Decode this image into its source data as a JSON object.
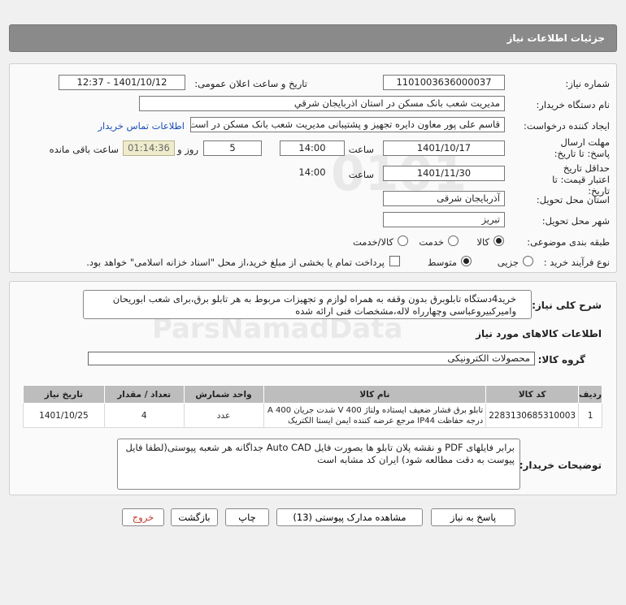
{
  "header": {
    "title": "جزئیات اطلاعات نیاز"
  },
  "form": {
    "need_number_label": "شماره نیاز:",
    "need_number": "1101003636000037",
    "announce_label": "تاریخ و ساعت اعلان عمومی:",
    "announce_value": "1401/10/12 - 12:37",
    "buyer_label": "نام دستگاه خریدار:",
    "buyer_value": "مدیریت شعب بانک مسکن در استان اذربایجان شرقي",
    "creator_label": "ایجاد کننده درخواست:",
    "creator_value": "قاسم علی پور معاون دایره تجهیز و پشتیبانی مدیریت شعب بانک مسکن در است",
    "contact_link": "اطلاعات تماس خریدار",
    "deadline_label": "مهلت ارسال پاسخ: تا تاریخ:",
    "deadline_date": "1401/10/17",
    "time_label": "ساعت",
    "deadline_time": "14:00",
    "days_value": "5",
    "days_label": "روز و",
    "remaining_time": "01:14:36",
    "remaining_label": "ساعت باقی مانده",
    "validity_label": "حداقل تاریخ اعتبار قیمت: تا تاریخ:",
    "validity_date": "1401/11/30",
    "validity_time_label": "ساعت",
    "validity_time": "14:00",
    "province_label": "استان محل تحویل:",
    "province_value": "آذربایجان شرقی",
    "city_label": "شهر محل تحویل:",
    "city_value": "تبریز",
    "category_label": "طبقه بندی موضوعی:",
    "category_options": [
      "کالا",
      "خدمت",
      "کالا/خدمت"
    ],
    "category_selected": "کالا",
    "process_label": "نوع فرآیند خرید :",
    "process_options": [
      "جزیی",
      "متوسط"
    ],
    "process_selected": "متوسط",
    "payment_note": "پرداخت تمام یا بخشی از مبلغ خرید،از محل \"اسناد خزانه اسلامی\" خواهد بود."
  },
  "summary": {
    "label": "شرح کلی نیاز:",
    "text": "خرید4دستگاه تابلوبرق بدون وقفه به همراه لوازم و تجهیزات مربوط به هر تابلو برق،برای شعب ابوریحان وامیرکبیروعباسی وچهارراه لاله،مشخصات فنی ارائه شده"
  },
  "goods": {
    "section_title": "اطلاعات کالاهای مورد نیاز",
    "group_label": "گروه کالا:",
    "group_value": "محصولات الکترونیکی",
    "columns": [
      "ردیف",
      "کد کالا",
      "نام کالا",
      "واحد شمارش",
      "تعداد / مقدار",
      "تاریخ نیاز"
    ],
    "rows": [
      {
        "row": "1",
        "code": "2283130685310003",
        "name": "تابلو برق فشار ضعیف ایستاده ولتاژ 400 V شدت جریان 400 A درجه حفاظت IP44 مرجع عرضه کننده ایمن ایستا الکتریک",
        "unit": "عدد",
        "qty": "4",
        "date": "1401/10/25"
      }
    ]
  },
  "buyer_notes": {
    "label": "توضیحات خریدار:",
    "text": "برابر فایلهای PDF و نقشه پلان تابلو ها بصورت فایل Auto CAD جداگانه هر شعبه پیوستی(لطفا فایل پیوست به دقت مطالعه شود) ایران کد مشابه است"
  },
  "buttons": {
    "reply": "پاسخ به نیاز",
    "attachments": "مشاهده مدارک پیوستی (13)",
    "print": "چاپ",
    "back": "بازگشت",
    "exit": "خروج"
  },
  "colors": {
    "header_bg": "#8a8a8a",
    "timer_bg": "#eeeccc",
    "exit_text": "#c0392b",
    "link": "#1a4fb6"
  }
}
